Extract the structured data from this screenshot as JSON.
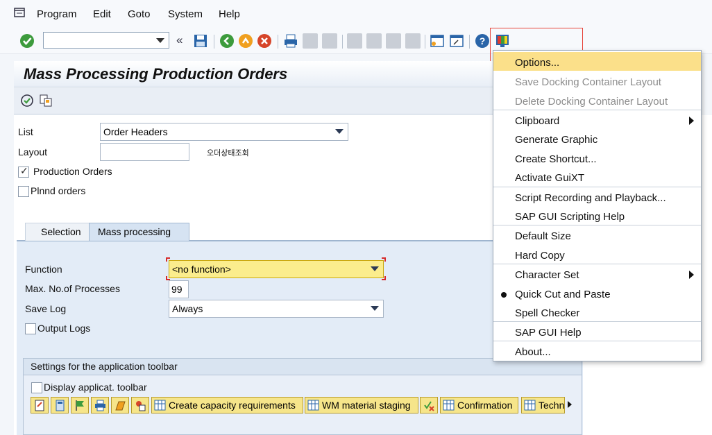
{
  "menubar": {
    "items": [
      {
        "label": "Program"
      },
      {
        "label": "Edit"
      },
      {
        "label": "Goto"
      },
      {
        "label": "System"
      },
      {
        "label": "Help"
      }
    ]
  },
  "toolbar": {
    "command_value": "",
    "icons": [
      "enter-icon",
      "back-icon",
      "save-icon",
      "back-green-icon",
      "exit-icon",
      "cancel-icon",
      "print-icon",
      "find-icon",
      "find-next-icon",
      "first-page-icon",
      "prev-page-icon",
      "next-page-icon",
      "last-page-icon",
      "new-session-icon",
      "shortcut-icon",
      "help-icon",
      "customize-layout-icon"
    ]
  },
  "page": {
    "title": "Mass Processing Production Orders"
  },
  "form": {
    "list_label": "List",
    "list_value": "Order Headers",
    "layout_label": "Layout",
    "layout_value": "",
    "layout_desc": "오더상태조회",
    "production_orders_label": "Production Orders",
    "production_orders_checked": true,
    "plnnd_orders_label": "Plnnd orders",
    "plnnd_orders_checked": false
  },
  "tabs": [
    {
      "label": "Selection",
      "active": false
    },
    {
      "label": "Mass processing",
      "active": true
    }
  ],
  "mass": {
    "function_label": "Function",
    "function_value": "<no function>",
    "max_label": "Max. No.of Processes",
    "max_value": "99",
    "savelog_label": "Save Log",
    "savelog_value": "Always",
    "output_logs_label": "Output Logs",
    "output_logs_checked": false
  },
  "settings": {
    "title": "Settings for the application toolbar",
    "display_label": "Display applicat. toolbar",
    "display_checked": false,
    "buttons": [
      {
        "label": "Create capacity requirements"
      },
      {
        "label": "WM material staging"
      },
      {
        "label": "Confirmation"
      },
      {
        "label": "Techn"
      }
    ]
  },
  "context_menu": {
    "items": [
      {
        "label": "Options...",
        "highlighted": true
      },
      {
        "label": "Save Docking Container Layout",
        "disabled": true
      },
      {
        "label": "Delete Docking Container Layout",
        "disabled": true
      },
      {
        "label": "Clipboard",
        "submenu": true
      },
      {
        "label": "Generate Graphic"
      },
      {
        "label": "Create Shortcut..."
      },
      {
        "label": "Activate GuiXT"
      },
      {
        "label": "Script Recording and Playback..."
      },
      {
        "label": "SAP GUI Scripting Help"
      },
      {
        "label": "Default Size"
      },
      {
        "label": "Hard Copy"
      },
      {
        "label": "Character Set",
        "submenu": true
      },
      {
        "label": "Quick Cut and Paste",
        "checked": true
      },
      {
        "label": "Spell Checker"
      },
      {
        "label": "SAP GUI Help"
      },
      {
        "label": "About..."
      }
    ]
  },
  "colors": {
    "required_field": "#fbed8d",
    "menu_highlight": "#fbe08a",
    "annotation_frame": "#e6443a"
  }
}
